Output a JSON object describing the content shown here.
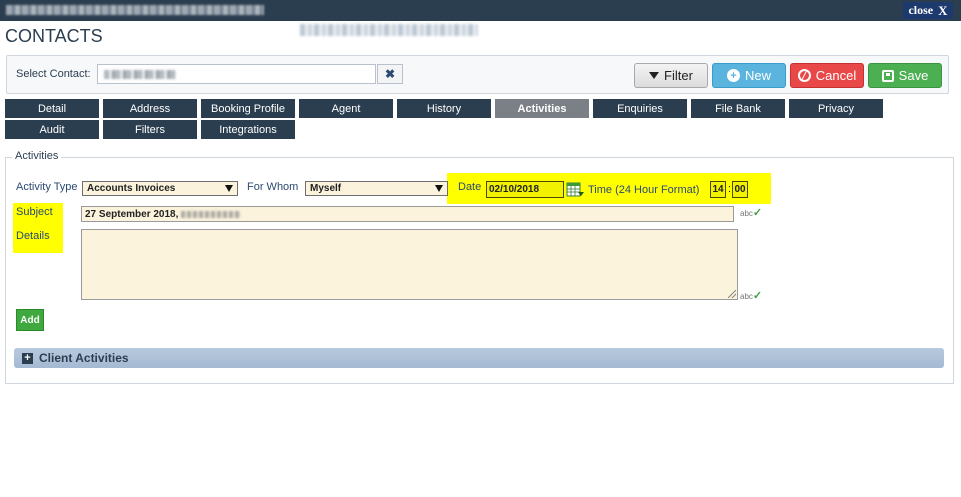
{
  "window": {
    "close_label": "close",
    "close_x": "X"
  },
  "page": {
    "title": "CONTACTS"
  },
  "contact_bar": {
    "label": "Select Contact:",
    "clear_icon": "x-icon",
    "buttons": {
      "filter": "Filter",
      "new": "New",
      "cancel": "Cancel",
      "save": "Save"
    }
  },
  "tabs": [
    {
      "label": "Detail"
    },
    {
      "label": "Address"
    },
    {
      "label": "Booking Profile"
    },
    {
      "label": "Agent"
    },
    {
      "label": "History"
    },
    {
      "label": "Activities",
      "active": true
    },
    {
      "label": "Enquiries"
    },
    {
      "label": "File Bank"
    },
    {
      "label": "Privacy"
    },
    {
      "label": "Audit"
    },
    {
      "label": "Filters"
    },
    {
      "label": "Integrations"
    }
  ],
  "activities": {
    "legend": "Activities",
    "activity_type_label": "Activity Type",
    "activity_type_value": "Accounts Invoices",
    "for_whom_label": "For Whom",
    "for_whom_value": "Myself",
    "date_label": "Date",
    "date_value": "02/10/2018",
    "time_label": "Time (24 Hour Format)",
    "time_hour": "14",
    "time_separator": ":",
    "time_minute": "00",
    "subject_label": "Subject",
    "subject_value": "27 September 2018,",
    "details_label": "Details",
    "details_value": "",
    "spellcheck_text": "abc",
    "add_label": "Add",
    "highlight_color": "#ffff00"
  },
  "client_activities": {
    "label": "Client Activities"
  }
}
